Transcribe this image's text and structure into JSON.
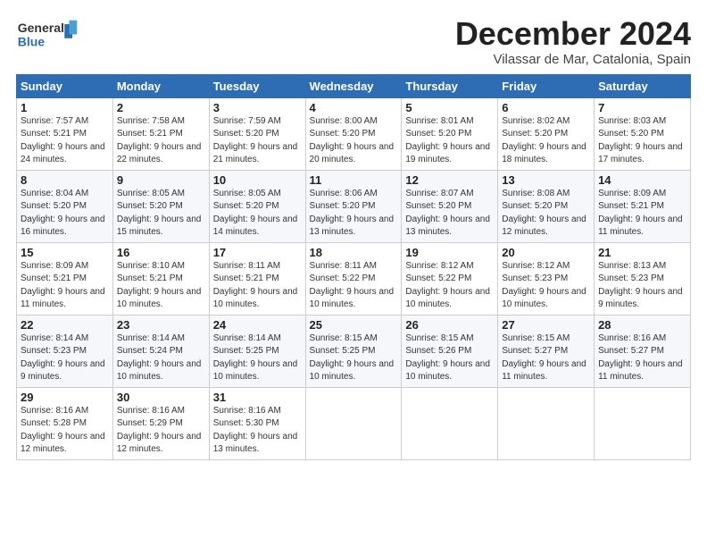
{
  "header": {
    "logo_general": "General",
    "logo_blue": "Blue",
    "month_title": "December 2024",
    "location": "Vilassar de Mar, Catalonia, Spain"
  },
  "days_of_week": [
    "Sunday",
    "Monday",
    "Tuesday",
    "Wednesday",
    "Thursday",
    "Friday",
    "Saturday"
  ],
  "weeks": [
    [
      {
        "day": "1",
        "sunrise": "Sunrise: 7:57 AM",
        "sunset": "Sunset: 5:21 PM",
        "daylight": "Daylight: 9 hours and 24 minutes."
      },
      {
        "day": "2",
        "sunrise": "Sunrise: 7:58 AM",
        "sunset": "Sunset: 5:21 PM",
        "daylight": "Daylight: 9 hours and 22 minutes."
      },
      {
        "day": "3",
        "sunrise": "Sunrise: 7:59 AM",
        "sunset": "Sunset: 5:20 PM",
        "daylight": "Daylight: 9 hours and 21 minutes."
      },
      {
        "day": "4",
        "sunrise": "Sunrise: 8:00 AM",
        "sunset": "Sunset: 5:20 PM",
        "daylight": "Daylight: 9 hours and 20 minutes."
      },
      {
        "day": "5",
        "sunrise": "Sunrise: 8:01 AM",
        "sunset": "Sunset: 5:20 PM",
        "daylight": "Daylight: 9 hours and 19 minutes."
      },
      {
        "day": "6",
        "sunrise": "Sunrise: 8:02 AM",
        "sunset": "Sunset: 5:20 PM",
        "daylight": "Daylight: 9 hours and 18 minutes."
      },
      {
        "day": "7",
        "sunrise": "Sunrise: 8:03 AM",
        "sunset": "Sunset: 5:20 PM",
        "daylight": "Daylight: 9 hours and 17 minutes."
      }
    ],
    [
      {
        "day": "8",
        "sunrise": "Sunrise: 8:04 AM",
        "sunset": "Sunset: 5:20 PM",
        "daylight": "Daylight: 9 hours and 16 minutes."
      },
      {
        "day": "9",
        "sunrise": "Sunrise: 8:05 AM",
        "sunset": "Sunset: 5:20 PM",
        "daylight": "Daylight: 9 hours and 15 minutes."
      },
      {
        "day": "10",
        "sunrise": "Sunrise: 8:05 AM",
        "sunset": "Sunset: 5:20 PM",
        "daylight": "Daylight: 9 hours and 14 minutes."
      },
      {
        "day": "11",
        "sunrise": "Sunrise: 8:06 AM",
        "sunset": "Sunset: 5:20 PM",
        "daylight": "Daylight: 9 hours and 13 minutes."
      },
      {
        "day": "12",
        "sunrise": "Sunrise: 8:07 AM",
        "sunset": "Sunset: 5:20 PM",
        "daylight": "Daylight: 9 hours and 13 minutes."
      },
      {
        "day": "13",
        "sunrise": "Sunrise: 8:08 AM",
        "sunset": "Sunset: 5:20 PM",
        "daylight": "Daylight: 9 hours and 12 minutes."
      },
      {
        "day": "14",
        "sunrise": "Sunrise: 8:09 AM",
        "sunset": "Sunset: 5:21 PM",
        "daylight": "Daylight: 9 hours and 11 minutes."
      }
    ],
    [
      {
        "day": "15",
        "sunrise": "Sunrise: 8:09 AM",
        "sunset": "Sunset: 5:21 PM",
        "daylight": "Daylight: 9 hours and 11 minutes."
      },
      {
        "day": "16",
        "sunrise": "Sunrise: 8:10 AM",
        "sunset": "Sunset: 5:21 PM",
        "daylight": "Daylight: 9 hours and 10 minutes."
      },
      {
        "day": "17",
        "sunrise": "Sunrise: 8:11 AM",
        "sunset": "Sunset: 5:21 PM",
        "daylight": "Daylight: 9 hours and 10 minutes."
      },
      {
        "day": "18",
        "sunrise": "Sunrise: 8:11 AM",
        "sunset": "Sunset: 5:22 PM",
        "daylight": "Daylight: 9 hours and 10 minutes."
      },
      {
        "day": "19",
        "sunrise": "Sunrise: 8:12 AM",
        "sunset": "Sunset: 5:22 PM",
        "daylight": "Daylight: 9 hours and 10 minutes."
      },
      {
        "day": "20",
        "sunrise": "Sunrise: 8:12 AM",
        "sunset": "Sunset: 5:23 PM",
        "daylight": "Daylight: 9 hours and 10 minutes."
      },
      {
        "day": "21",
        "sunrise": "Sunrise: 8:13 AM",
        "sunset": "Sunset: 5:23 PM",
        "daylight": "Daylight: 9 hours and 9 minutes."
      }
    ],
    [
      {
        "day": "22",
        "sunrise": "Sunrise: 8:14 AM",
        "sunset": "Sunset: 5:23 PM",
        "daylight": "Daylight: 9 hours and 9 minutes."
      },
      {
        "day": "23",
        "sunrise": "Sunrise: 8:14 AM",
        "sunset": "Sunset: 5:24 PM",
        "daylight": "Daylight: 9 hours and 10 minutes."
      },
      {
        "day": "24",
        "sunrise": "Sunrise: 8:14 AM",
        "sunset": "Sunset: 5:25 PM",
        "daylight": "Daylight: 9 hours and 10 minutes."
      },
      {
        "day": "25",
        "sunrise": "Sunrise: 8:15 AM",
        "sunset": "Sunset: 5:25 PM",
        "daylight": "Daylight: 9 hours and 10 minutes."
      },
      {
        "day": "26",
        "sunrise": "Sunrise: 8:15 AM",
        "sunset": "Sunset: 5:26 PM",
        "daylight": "Daylight: 9 hours and 10 minutes."
      },
      {
        "day": "27",
        "sunrise": "Sunrise: 8:15 AM",
        "sunset": "Sunset: 5:27 PM",
        "daylight": "Daylight: 9 hours and 11 minutes."
      },
      {
        "day": "28",
        "sunrise": "Sunrise: 8:16 AM",
        "sunset": "Sunset: 5:27 PM",
        "daylight": "Daylight: 9 hours and 11 minutes."
      }
    ],
    [
      {
        "day": "29",
        "sunrise": "Sunrise: 8:16 AM",
        "sunset": "Sunset: 5:28 PM",
        "daylight": "Daylight: 9 hours and 12 minutes."
      },
      {
        "day": "30",
        "sunrise": "Sunrise: 8:16 AM",
        "sunset": "Sunset: 5:29 PM",
        "daylight": "Daylight: 9 hours and 12 minutes."
      },
      {
        "day": "31",
        "sunrise": "Sunrise: 8:16 AM",
        "sunset": "Sunset: 5:30 PM",
        "daylight": "Daylight: 9 hours and 13 minutes."
      },
      null,
      null,
      null,
      null
    ]
  ]
}
